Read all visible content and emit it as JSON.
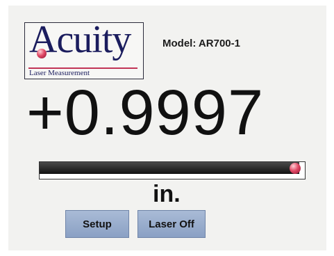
{
  "logo": {
    "wordmark": "Acuity",
    "subtitle": "Laser Measurement"
  },
  "model_label": "Model:  AR700-1",
  "reading": {
    "value": "+0.9997",
    "unit": "in.",
    "level": 0.98
  },
  "buttons": {
    "setup": "Setup",
    "laser_off": "Laser Off"
  },
  "colors": {
    "logo_text": "#1b1d5e",
    "logo_accent": "#c23456",
    "button": "#9db1d0"
  }
}
